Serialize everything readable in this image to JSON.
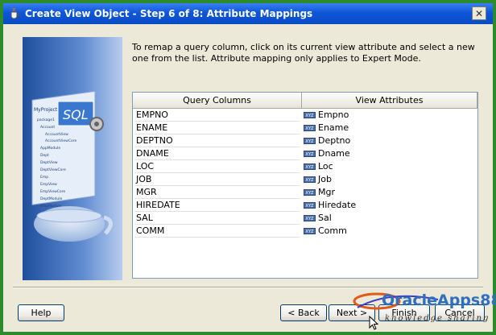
{
  "window": {
    "title": "Create View Object - Step 6 of 8: Attribute Mappings",
    "close_glyph": "✕"
  },
  "instruction": "To remap a query column, click on its current view attribute and select a new one from the list.  Attribute mapping only applies to Expert Mode.",
  "grid": {
    "headers": {
      "query": "Query Columns",
      "view": "View Attributes"
    },
    "attr_icon_text": "XYZ",
    "rows": [
      {
        "column": "EMPNO",
        "attribute": "Empno"
      },
      {
        "column": "ENAME",
        "attribute": "Ename"
      },
      {
        "column": "DEPTNO",
        "attribute": "Deptno"
      },
      {
        "column": "DNAME",
        "attribute": "Dname"
      },
      {
        "column": "LOC",
        "attribute": "Loc"
      },
      {
        "column": "JOB",
        "attribute": "Job"
      },
      {
        "column": "MGR",
        "attribute": "Mgr"
      },
      {
        "column": "HIREDATE",
        "attribute": "Hiredate"
      },
      {
        "column": "SAL",
        "attribute": "Sal"
      },
      {
        "column": "COMM",
        "attribute": "Comm"
      }
    ]
  },
  "illustration": {
    "sql_label": "SQL",
    "tree_header": "MyProject1",
    "tree_items": [
      "package1",
      "Account",
      "AccountView",
      "AccountViewCore",
      "AppModule",
      "Dept",
      "DeptView",
      "DeptViewCore",
      "Emp",
      "EmpView",
      "EmpViewCore",
      "DeptModule",
      "EmpModule"
    ]
  },
  "buttons": {
    "help": "Help",
    "back": "< Back",
    "next": "Next >",
    "finish": "Finish",
    "cancel": "Cancel"
  },
  "watermark": {
    "brand": "OracleApps88",
    "tagline": "knowledge sharing"
  }
}
